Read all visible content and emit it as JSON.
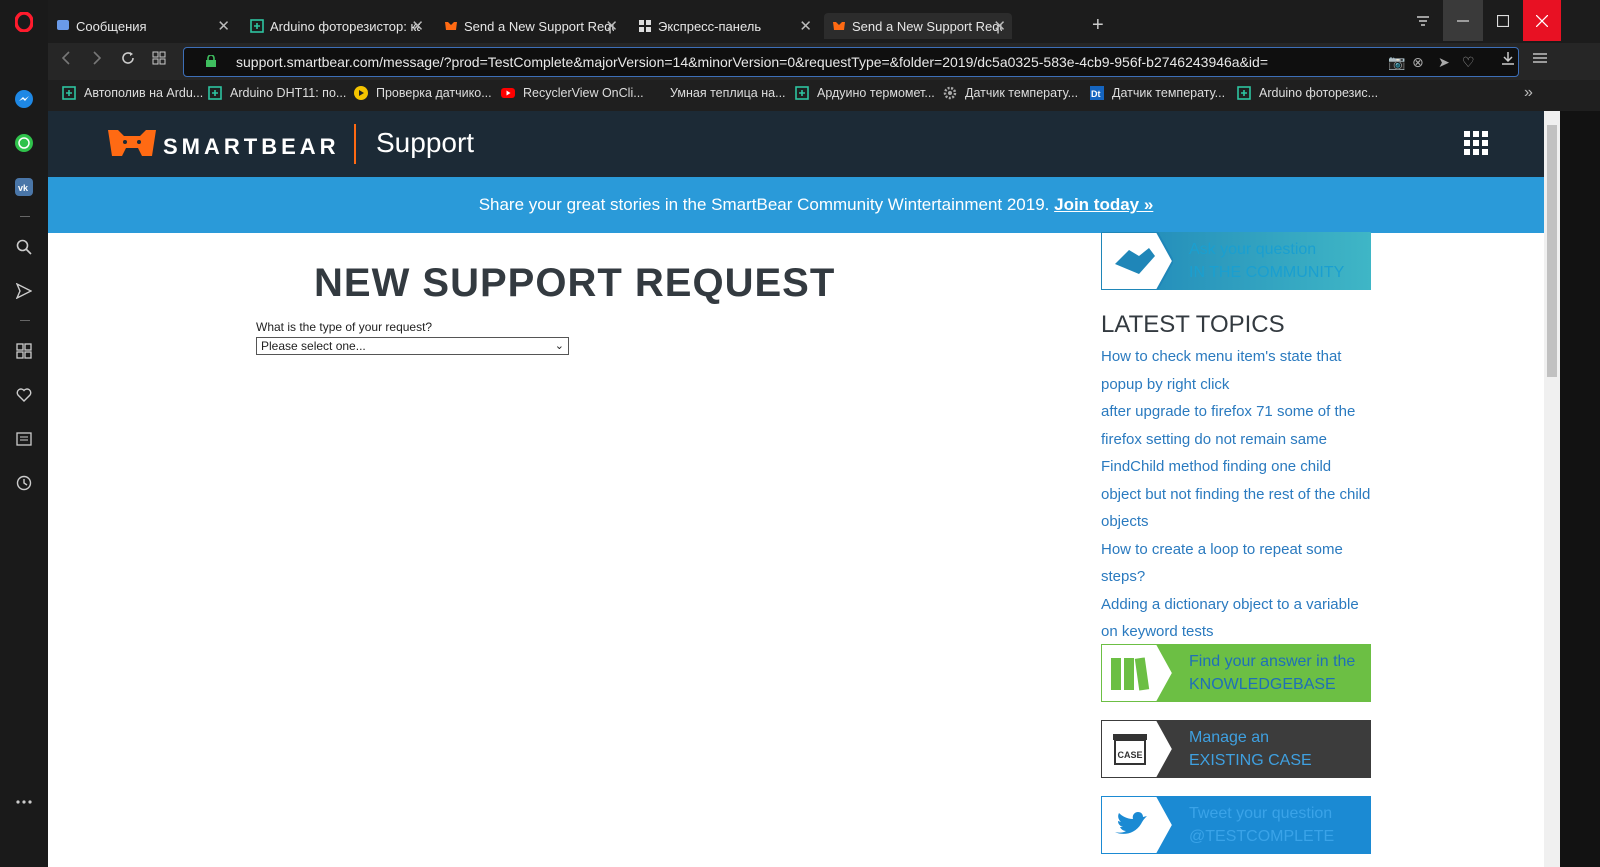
{
  "tabs": [
    {
      "title": "Сообщения",
      "icon": "messages-icon"
    },
    {
      "title": "Arduino фоторезистор: ка",
      "icon": "bookmark-plus-icon"
    },
    {
      "title": "Send a New Support Reque",
      "icon": "smartbear-icon"
    },
    {
      "title": "Экспресс-панель",
      "icon": "speed-dial-icon"
    },
    {
      "title": "Send a New Support Reque",
      "icon": "smartbear-icon"
    }
  ],
  "address": {
    "url": "support.smartbear.com/message/?prod=TestComplete&majorVersion=14&minorVersion=0&requestType=&folder=2019/dc5a0325-583e-4cb9-956f-b2746243946a&id="
  },
  "bookmarks": [
    "Автополив на Ardu...",
    "Arduino DHT11: по...",
    "Проверка датчико...",
    "RecyclerView OnCli...",
    "Умная теплица на...",
    "Ардуино термомет...",
    "Датчик температу...",
    "Датчик температу...",
    "Arduino фоторезис..."
  ],
  "header": {
    "logo_text": "SMARTBEAR",
    "support": "Support"
  },
  "banner": {
    "text": "Share your great stories in the SmartBear Community Wintertainment 2019.",
    "link": "Join today »"
  },
  "form": {
    "title": "NEW SUPPORT REQUEST",
    "question": "What is the type of your request?",
    "selected": "Please select one..."
  },
  "sidebar": {
    "community": {
      "line1": "Ask your question",
      "line2": "IN THE COMMUNITY"
    },
    "topics_heading": "LATEST TOPICS",
    "topics": [
      "How to check menu item's state that popup by right click",
      "after upgrade to firefox 71 some of the firefox setting do not remain same",
      "FindChild method finding one child object but not finding the rest of the child objects",
      "How to create a loop to repeat some steps?",
      "Adding a dictionary object to a variable on keyword tests"
    ],
    "knowledgebase": {
      "line1": "Find your answer in the",
      "line2": "KNOWLEDGEBASE"
    },
    "case": {
      "line1": "Manage an",
      "line2": "EXISTING CASE",
      "icon_label": "CASE"
    },
    "twitter": {
      "line1": "Tweet your question",
      "line2": "@TESTCOMPLETE"
    }
  },
  "colors": {
    "header_bg": "#1c2a36",
    "banner_bg": "#2a9ad9",
    "accent_orange": "#ff6a13",
    "link_blue": "#2a7abf",
    "kb_green": "#6cbf44",
    "case_dark": "#3c3c3c",
    "twitter_blue": "#1b8ad3"
  }
}
